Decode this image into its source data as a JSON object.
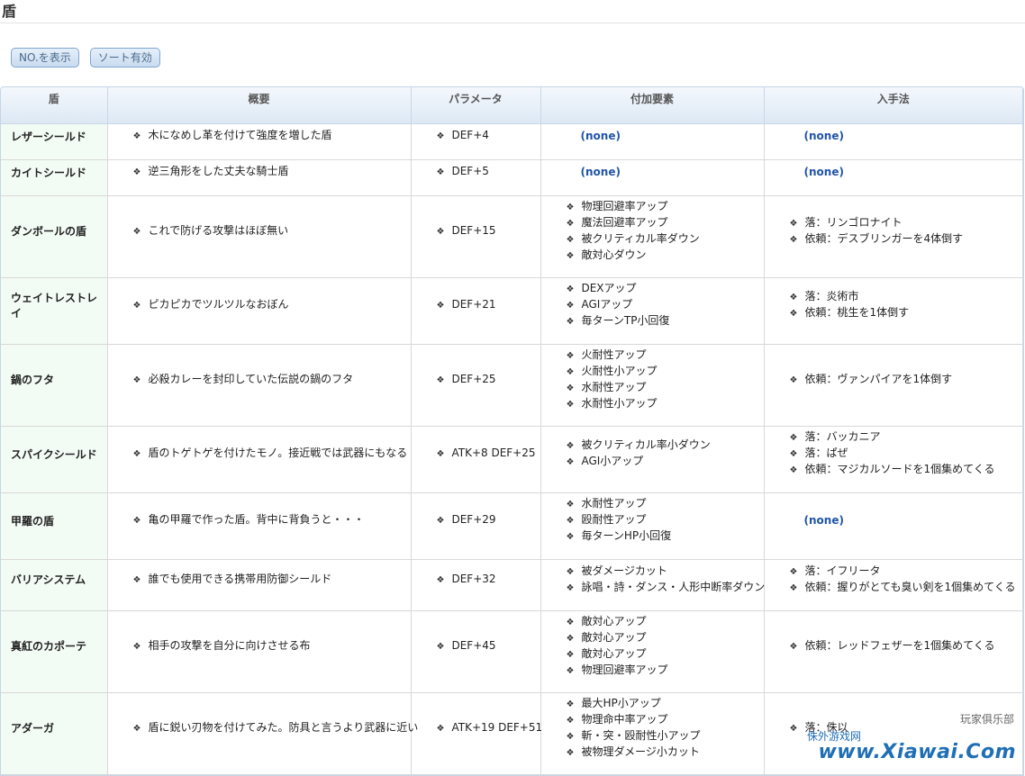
{
  "page": {
    "heading": "盾"
  },
  "buttons": {
    "show_no": "NO.を表示",
    "sort": "ソート有効"
  },
  "table": {
    "headers": [
      "盾",
      "概要",
      "パラメータ",
      "付加要素",
      "入手法"
    ],
    "none_label": "(none)",
    "rows": [
      {
        "name": "レザーシールド",
        "summary": "木になめし革を付けて強度を増した盾",
        "param": "DEF+4",
        "extras": [],
        "sources": [],
        "h": 40
      },
      {
        "name": "カイトシールド",
        "summary": "逆三角形をした丈夫な騎士盾",
        "param": "DEF+5",
        "extras": [],
        "sources": [],
        "h": 40
      },
      {
        "name": "ダンボールの盾",
        "summary": "これで防げる攻撃はほぼ無い",
        "param": "DEF+15",
        "extras": [
          "物理回避率アップ",
          "魔法回避率アップ",
          "被クリティカル率ダウン",
          "敵対心ダウン"
        ],
        "sources": [
          "落：リンゴロナイト",
          "依頼：デスブリンガーを4体倒す"
        ],
        "h": 91
      },
      {
        "name": "ウェイトレストレイ",
        "summary": "ピカピカでツルツルなおぼん",
        "param": "DEF+21",
        "extras": [
          "DEXアップ",
          "AGIアップ",
          "毎ターンTP小回復"
        ],
        "sources": [
          "落：炎術市",
          "依頼：桃生を1体倒す"
        ],
        "h": 74
      },
      {
        "name": "鍋のフタ",
        "summary": "必殺カレーを封印していた伝説の鍋のフタ",
        "param": "DEF+25",
        "extras": [
          "火耐性アップ",
          "火耐性小アップ",
          "水耐性アップ",
          "水耐性小アップ"
        ],
        "sources": [
          "依頼：ヴァンパイアを1体倒す"
        ],
        "h": 91
      },
      {
        "name": "スパイクシールド",
        "summary": "盾のトゲトゲを付けたモノ。接近戦では武器にもなる",
        "param": "ATK+8 DEF+25",
        "extras": [
          "被クリティカル率小ダウン",
          "AGI小アップ"
        ],
        "sources": [
          "落：バッカニア",
          "落：ぱぜ",
          "依頼：マジカルソードを1個集めてくる"
        ],
        "h": 74
      },
      {
        "name": "甲羅の盾",
        "summary": "亀の甲羅で作った盾。背中に背負うと・・・",
        "param": "DEF+29",
        "extras": [
          "水耐性アップ",
          "殴耐性アップ",
          "毎ターンHP小回復"
        ],
        "sources": [],
        "h": 74
      },
      {
        "name": "バリアシステム",
        "summary": "誰でも使用できる携帯用防御シールド",
        "param": "DEF+32",
        "extras": [
          "被ダメージカット",
          "詠唱・詩・ダンス・人形中断率ダウン"
        ],
        "sources": [
          "落：イフリータ",
          "依頼：握りがとても臭い剣を1個集めてくる"
        ],
        "h": 57
      },
      {
        "name": "真紅のカポーテ",
        "summary": "相手の攻撃を自分に向けさせる布",
        "param": "DEF+45",
        "extras": [
          "敵対心アップ",
          "敵対心アップ",
          "敵対心アップ",
          "物理回避率アップ"
        ],
        "sources": [
          "依頼：レッドフェザーを1個集めてくる"
        ],
        "h": 91
      },
      {
        "name": "アダーガ",
        "summary": "盾に鋭い刃物を付けてみた。防具と言うより武器に近い",
        "param": "ATK+19 DEF+51",
        "extras": [
          "最大HP小アップ",
          "物理命中率アップ",
          "斬・突・殴耐性小アップ",
          "被物理ダメージ小カット"
        ],
        "sources": [
          "落：侏以"
        ],
        "h": 91
      }
    ]
  },
  "watermark": {
    "brand": "侏外游戏网",
    "club": "玩家俱乐部",
    "site": "www.Xiawai.Com"
  }
}
